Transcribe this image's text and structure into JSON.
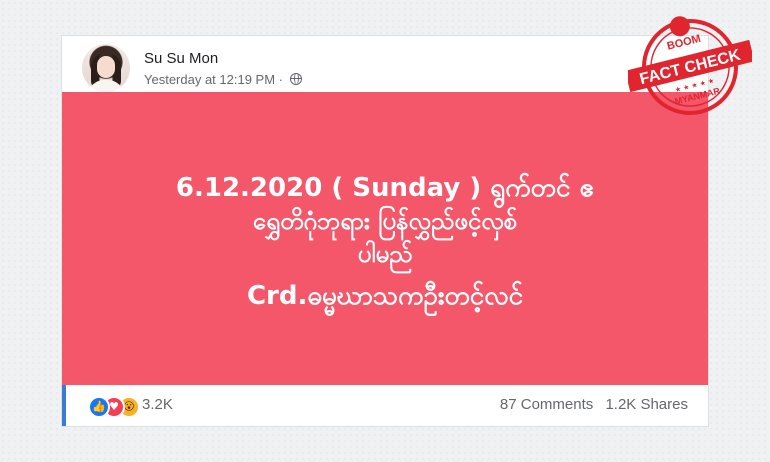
{
  "post": {
    "author": "Su Su Mon",
    "timestamp": "Yesterday at 12:19 PM ·",
    "privacy_icon": "globe-icon",
    "image_lines": [
      "6.12.2020 ( Sunday ) ရွက်တင် ဧ",
      "ရွှေတိဂုံဘုရား ပြန်လွှည်ဖင့်လှစ်",
      "ပါမည်",
      "Crd.ဓမ္မဃာသကဦးတင့်လင်"
    ],
    "image_background": "#f4566a"
  },
  "footer": {
    "reaction_icons": [
      "like-icon",
      "love-icon",
      "wow-icon"
    ],
    "reaction_count": "3.2K",
    "comments": "87 Comments",
    "shares": "1.2K Shares"
  },
  "badge": {
    "top": "BOOM",
    "main": "FACT CHECK",
    "bottom": "MYANMAR",
    "color": "#e0252f"
  }
}
